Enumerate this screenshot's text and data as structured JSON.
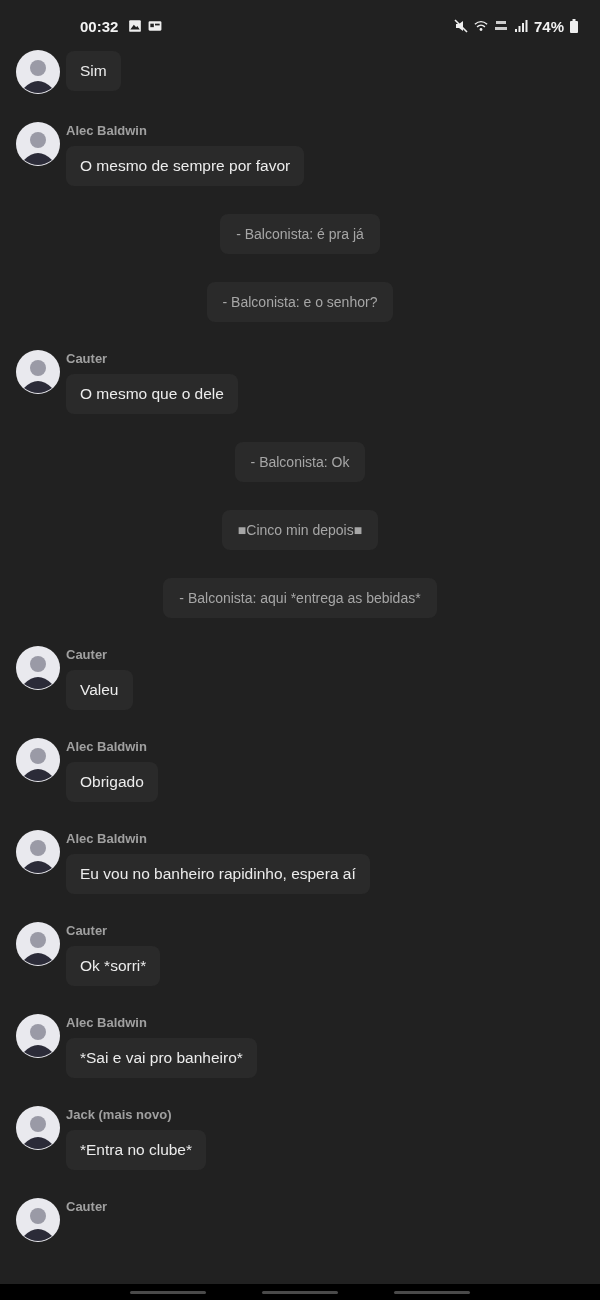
{
  "status_bar": {
    "time": "00:32",
    "battery": "74%"
  },
  "chat": [
    {
      "kind": "message",
      "text": "Sim"
    },
    {
      "kind": "message",
      "sender": "Alec Baldwin",
      "text": "O mesmo de sempre por favor"
    },
    {
      "kind": "narration",
      "text": "- Balconista: é pra já"
    },
    {
      "kind": "narration",
      "text": "- Balconista: e o senhor?"
    },
    {
      "kind": "message",
      "sender": "Cauter",
      "text": "O mesmo que o dele"
    },
    {
      "kind": "narration",
      "text": "- Balconista: Ok"
    },
    {
      "kind": "narration",
      "text": "■Cinco min depois■"
    },
    {
      "kind": "narration",
      "text": "- Balconista: aqui *entrega as bebidas*"
    },
    {
      "kind": "message",
      "sender": "Cauter",
      "text": "Valeu"
    },
    {
      "kind": "message",
      "sender": "Alec Baldwin",
      "text": "Obrigado"
    },
    {
      "kind": "message",
      "sender": "Alec Baldwin",
      "text": "Eu vou no banheiro rapidinho, espera aí"
    },
    {
      "kind": "message",
      "sender": "Cauter",
      "text": "Ok *sorri*"
    },
    {
      "kind": "message",
      "sender": "Alec Baldwin",
      "text": "*Sai e vai pro banheiro*"
    },
    {
      "kind": "message",
      "sender": "Jack (mais novo)",
      "text": "*Entra no clube*"
    },
    {
      "kind": "message",
      "sender": "Cauter"
    }
  ]
}
